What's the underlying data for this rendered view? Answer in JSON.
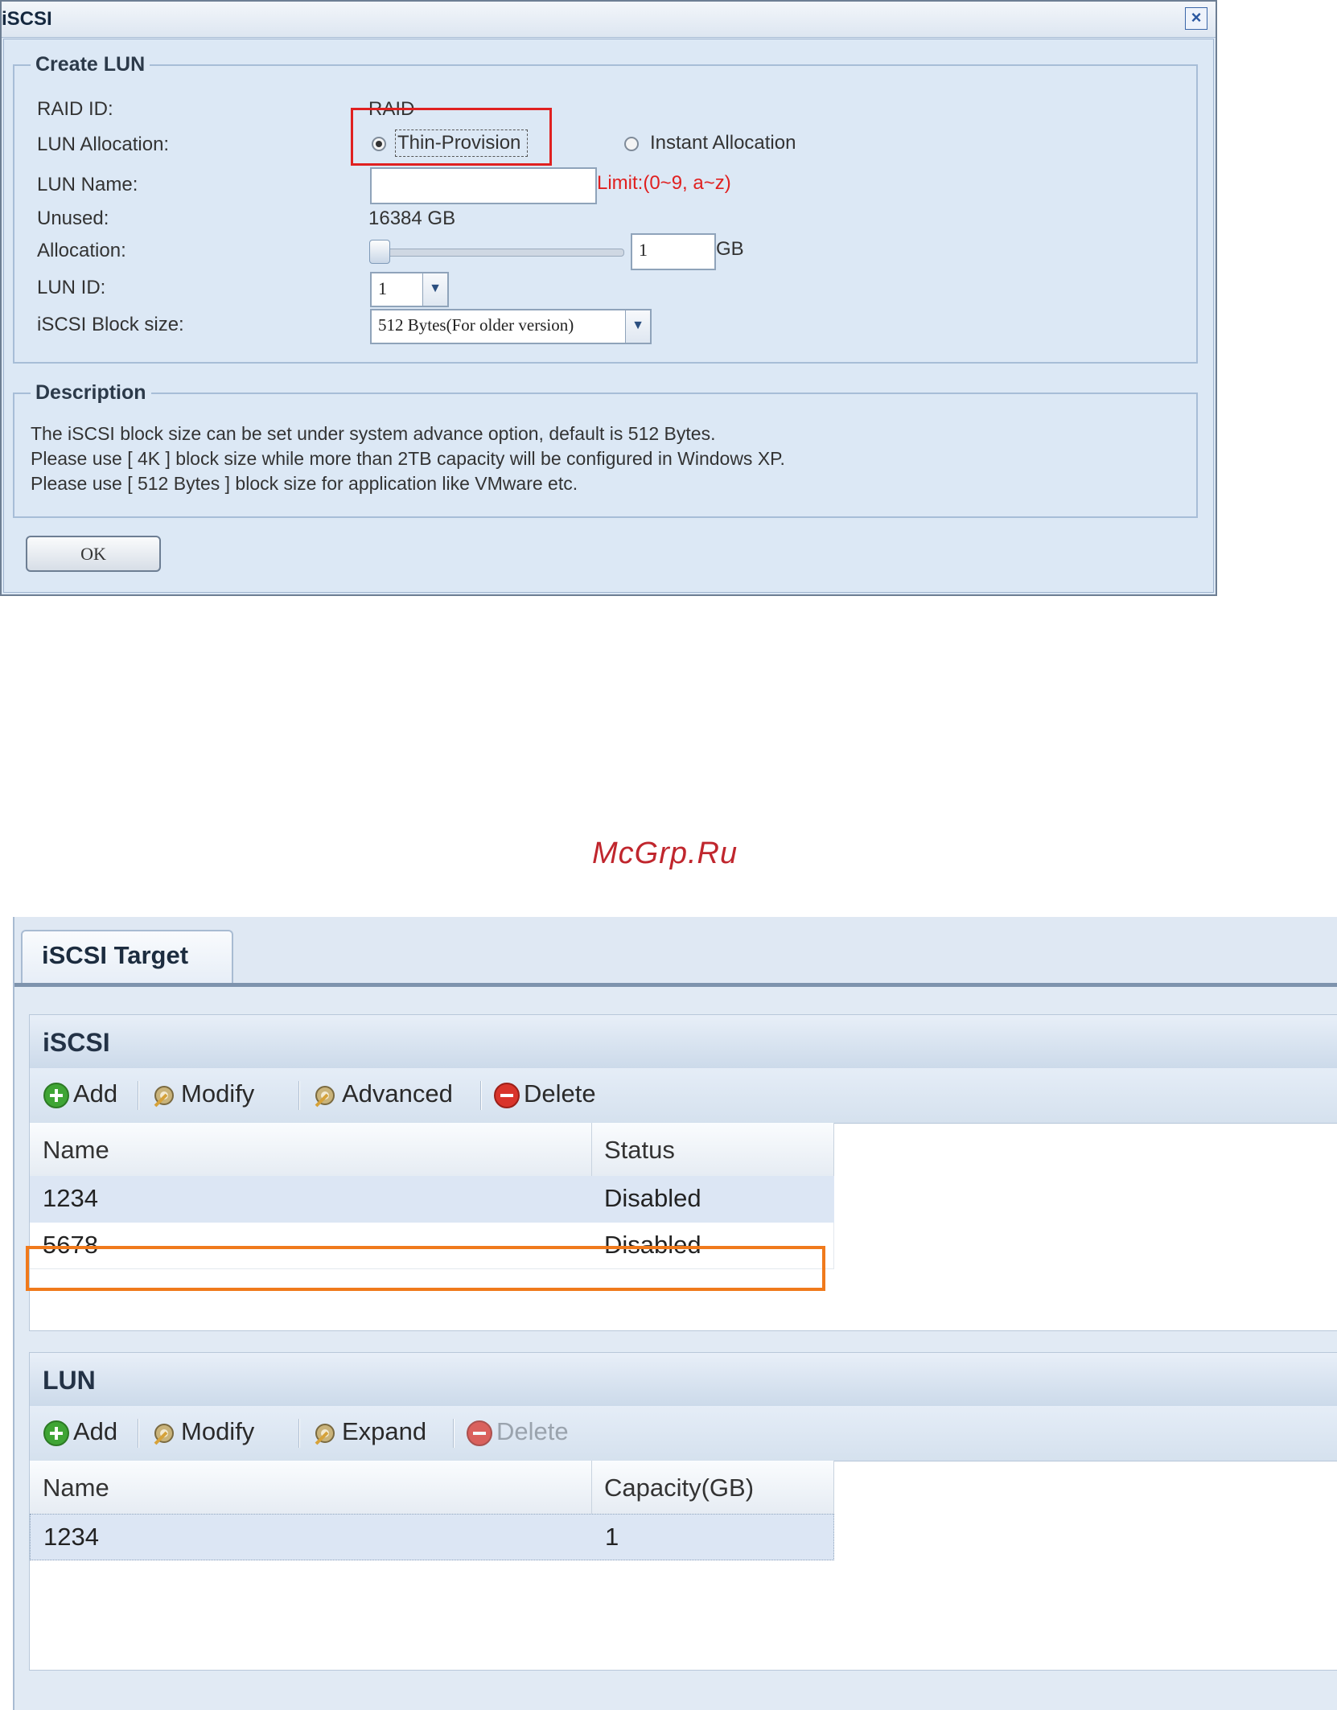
{
  "dialog": {
    "title": "iSCSI",
    "close_glyph": "×",
    "create_lun": {
      "legend": "Create LUN",
      "raid_id_label": "RAID ID:",
      "raid_id_value": "RAID",
      "allocation_label": "LUN Allocation:",
      "option_thin": "Thin-Provision",
      "option_instant": "Instant Allocation",
      "selected_option": "Thin-Provision",
      "name_label": "LUN Name:",
      "name_value": "",
      "name_limit": "Limit:(0~9, a~z)",
      "unused_label": "Unused:",
      "unused_value": "16384 GB",
      "alloc_amount_label": "Allocation:",
      "alloc_amount_value": "1",
      "alloc_unit": "GB",
      "alloc_slider_fraction": 0.0,
      "lun_id_label": "LUN ID:",
      "lun_id_value": "1",
      "block_size_label": "iSCSI Block size:",
      "block_size_value": "512 Bytes(For older version)"
    },
    "description": {
      "legend": "Description",
      "lines": [
        "The iSCSI block size can be set under system advance option, default is 512 Bytes.",
        "Please use [ 4K ] block size while more than 2TB capacity will be configured in Windows XP.",
        "Please use [ 512 Bytes ] block size for application like VMware etc."
      ]
    },
    "ok_label": "OK"
  },
  "watermark": "McGrp.Ru",
  "target_panel": {
    "tab_label": "iSCSI Target",
    "iscsi": {
      "title": "iSCSI",
      "toolbar": {
        "add": "Add",
        "modify": "Modify",
        "advanced": "Advanced",
        "delete": "Delete"
      },
      "columns": [
        "Name",
        "Status"
      ],
      "rows": [
        {
          "name": "1234",
          "status": "Disabled"
        },
        {
          "name": "5678",
          "status": "Disabled"
        }
      ]
    },
    "lun": {
      "title": "LUN",
      "toolbar": {
        "add": "Add",
        "modify": "Modify",
        "expand": "Expand",
        "delete": "Delete"
      },
      "columns": [
        "Name",
        "Capacity(GB)"
      ],
      "rows": [
        {
          "name": "1234",
          "capacity": "1"
        }
      ]
    }
  },
  "colors": {
    "highlight_red": "#e02020",
    "highlight_orange": "#f07a1c",
    "limit_text": "#e02020",
    "add_icon": "#3fa535",
    "delete_icon": "#d9342b"
  },
  "icons": [
    "close-icon",
    "add-icon",
    "modify-icon",
    "advanced-icon",
    "expand-icon",
    "delete-icon",
    "chevron-down-icon",
    "radio-icon"
  ]
}
